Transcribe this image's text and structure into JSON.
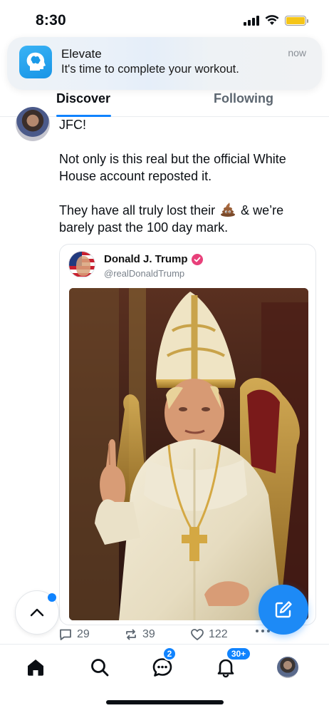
{
  "status_bar": {
    "time": "8:30"
  },
  "notification": {
    "app_name": "Elevate",
    "message": "It's time to complete your workout.",
    "time": "now"
  },
  "tabs": [
    {
      "label": "Discover",
      "active": true
    },
    {
      "label": "Following",
      "active": false
    }
  ],
  "post": {
    "paragraphs": [
      "JFC!",
      "Not only is this real but the official White House account reposted it.",
      "They have all truly lost their",
      "& we’re barely past the 100 day mark."
    ],
    "emoji_name": "poop-emoji",
    "embed": {
      "author_name": "Donald J. Trump",
      "author_handle": "@realDonaldTrump",
      "verified": true
    },
    "stats": {
      "replies": "29",
      "reposts": "39",
      "likes": "122"
    }
  },
  "bottom_nav": {
    "items": [
      {
        "name": "home",
        "active": true
      },
      {
        "name": "search"
      },
      {
        "name": "chat",
        "badge": "2"
      },
      {
        "name": "notifications",
        "badge": "30+"
      },
      {
        "name": "profile"
      }
    ]
  },
  "colors": {
    "accent": "#1083fe",
    "compose_button": "#1d8af6",
    "verified_badge": "#e8407a",
    "notification_icon": "#1895e6"
  }
}
